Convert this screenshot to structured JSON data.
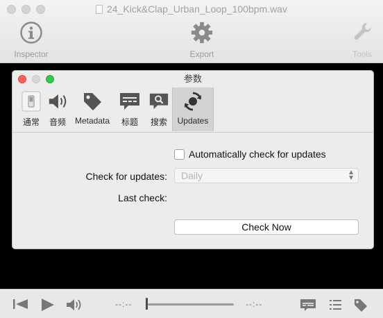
{
  "window": {
    "title": "24_Kick&Clap_Urban_Loop_100bpm.wav"
  },
  "toolbar": {
    "inspector_label": "Inspector",
    "export_label": "Export",
    "tools_label": "Tools"
  },
  "prefs": {
    "title": "参数",
    "tabs": [
      {
        "label": "通常",
        "icon": "switch-icon"
      },
      {
        "label": "音频",
        "icon": "speaker-icon"
      },
      {
        "label": "Metadata",
        "icon": "tag-icon"
      },
      {
        "label": "标题",
        "icon": "caption-icon"
      },
      {
        "label": "搜索",
        "icon": "search-icon"
      },
      {
        "label": "Updates",
        "icon": "sync-icon"
      }
    ],
    "active_tab": "Updates",
    "auto_check_label": "Automatically check for updates",
    "auto_check_checked": false,
    "check_for_updates_label": "Check for updates:",
    "check_for_updates_value": "Daily",
    "last_check_label": "Last check:",
    "check_now_label": "Check Now"
  },
  "player": {
    "time_elapsed": "--:--",
    "time_remaining": "--:--",
    "playback_position": 0
  }
}
